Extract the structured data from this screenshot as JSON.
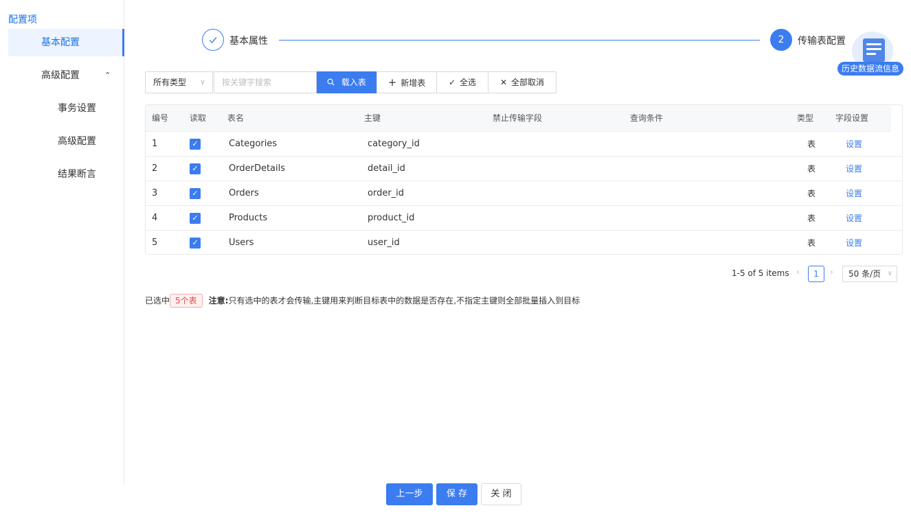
{
  "sidebar": {
    "title": "配置项",
    "items": [
      {
        "label": "基本配置"
      },
      {
        "label": "高级配置"
      },
      {
        "label": "事务设置"
      },
      {
        "label": "高级配置"
      },
      {
        "label": "结果断言"
      }
    ]
  },
  "steps": [
    {
      "label": "基本属性",
      "status": "done"
    },
    {
      "index": "2",
      "label": "传输表配置",
      "status": "current"
    }
  ],
  "history": {
    "label": "历史数据流信息"
  },
  "toolbar": {
    "type_select": "所有类型",
    "search_placeholder": "按关键字搜索",
    "load_table": "载入表",
    "add_table": "新增表",
    "select_all": "全选",
    "cancel_all": "全部取消"
  },
  "table": {
    "headers": [
      "编号",
      "读取",
      "表名",
      "主键",
      "禁止传输字段",
      "查询条件",
      "类型",
      "字段设置"
    ],
    "rows": [
      {
        "no": "1",
        "name": "Categories",
        "key": "category_id",
        "type": "表",
        "action": "设置"
      },
      {
        "no": "2",
        "name": "OrderDetails",
        "key": "detail_id",
        "type": "表",
        "action": "设置"
      },
      {
        "no": "3",
        "name": "Orders",
        "key": "order_id",
        "type": "表",
        "action": "设置"
      },
      {
        "no": "4",
        "name": "Products",
        "key": "product_id",
        "type": "表",
        "action": "设置"
      },
      {
        "no": "5",
        "name": "Users",
        "key": "user_id",
        "type": "表",
        "action": "设置"
      }
    ]
  },
  "pagination": {
    "total": "1-5 of 5 items",
    "page": "1",
    "page_size": "50 条/页"
  },
  "note": {
    "prefix": "已选中",
    "count": "5个表",
    "label": "注意:",
    "text": "只有选中的表才会传输,主键用来判断目标表中的数据是否存在,不指定主键则全部批量插入到目标"
  },
  "footer": {
    "prev": "上一步",
    "save": "保 存",
    "close": "关 闭"
  },
  "colors": {
    "primary": "#3b7cf0",
    "danger": "#e5484d"
  }
}
